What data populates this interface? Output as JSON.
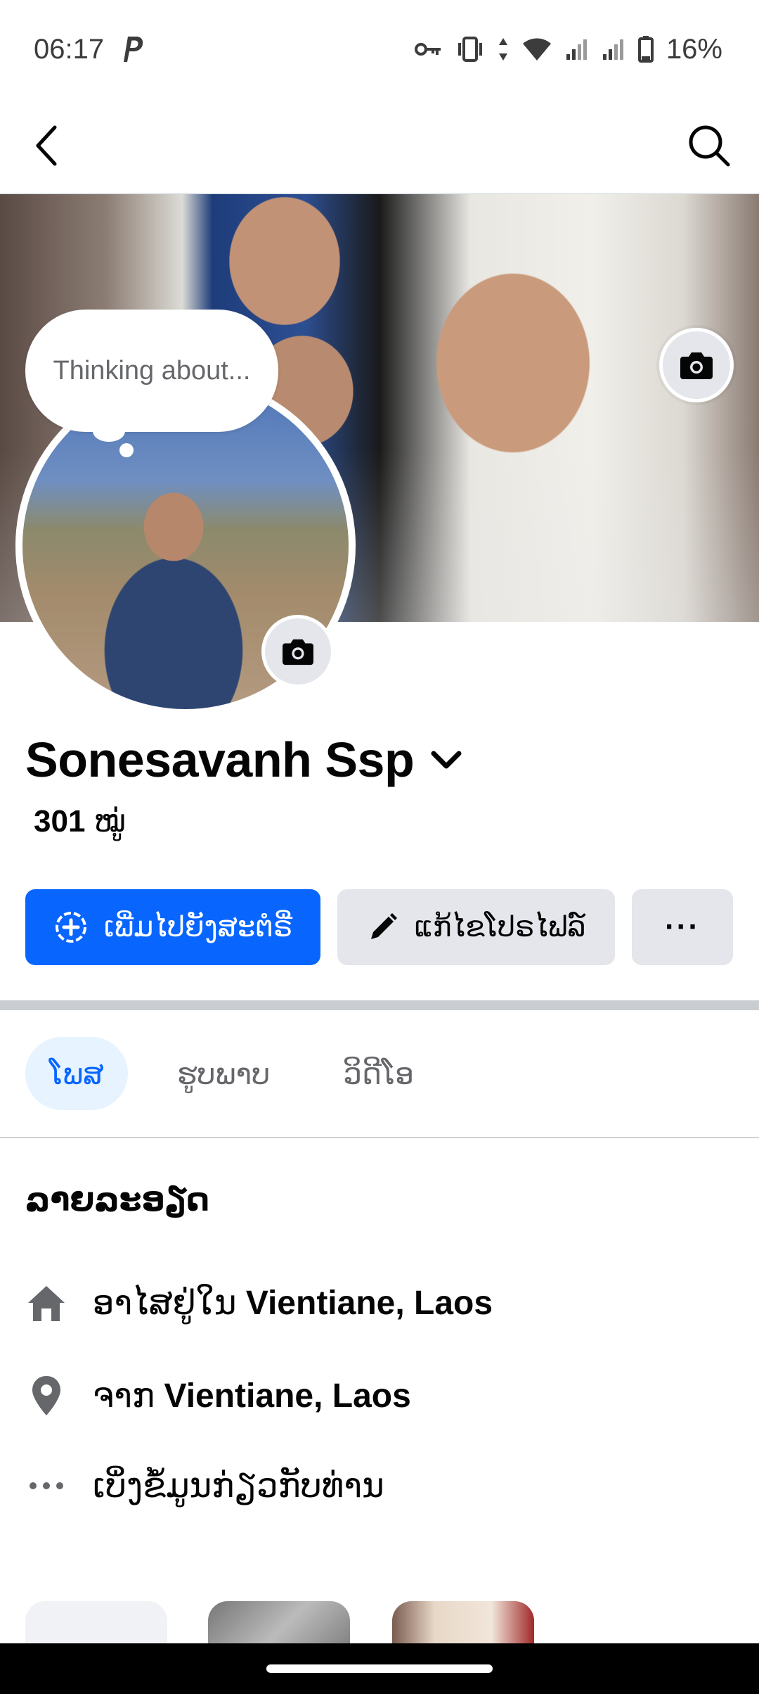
{
  "status_bar": {
    "time": "06:17",
    "battery": "16%",
    "icons": [
      "parking-icon",
      "key-icon",
      "vibrate-icon",
      "data-arrows-icon",
      "wifi-icon",
      "signal-icon",
      "signal-icon",
      "battery-icon"
    ]
  },
  "header": {
    "back_icon": "chevron-left-icon",
    "search_icon": "search-icon"
  },
  "profile": {
    "thought_bubble": "Thinking about...",
    "name": "Sonesavanh Ssp",
    "friends_count": "301",
    "friends_label": "ໝູ່"
  },
  "actions": {
    "add_story": "ເພີ່ມໄປຍັງສະຕໍຣີ່",
    "edit_profile": "ແກ້ໄຂໂປຣໄຟລ໌",
    "more": "···"
  },
  "tabs": [
    {
      "label": "ໂພສ",
      "active": true
    },
    {
      "label": "ຮູບພາບ",
      "active": false
    },
    {
      "label": "ວິດີໂອ",
      "active": false
    }
  ],
  "details": {
    "title": "ລາຍລະອຽດ",
    "lives_prefix": "ອາໄສຢູ່ໃນ",
    "lives_place": "Vientiane, Laos",
    "from_prefix": "ຈາກ",
    "from_place": "Vientiane, Laos",
    "see_more": "ເບິ່ງຂໍ້ມູນກ່ຽວກັບທ່ານ"
  },
  "colors": {
    "primary": "#0866ff",
    "secondary_bg": "#e4e6eb",
    "tab_active_bg": "#e7f3ff",
    "muted_text": "#65676b"
  }
}
